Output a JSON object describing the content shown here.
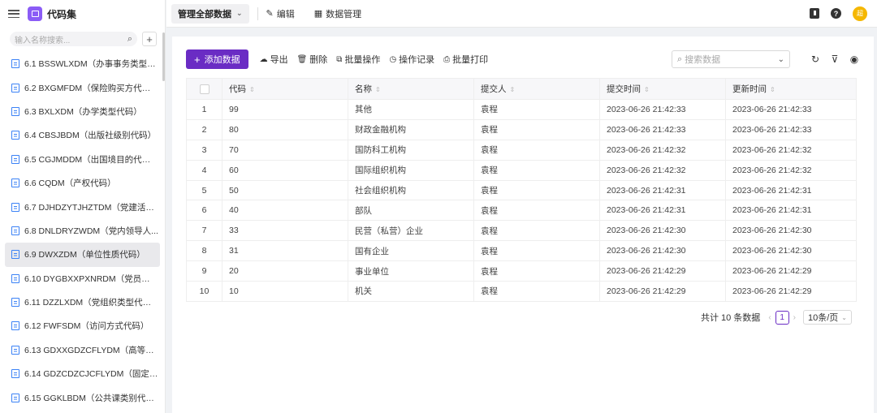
{
  "app": {
    "title": "代码集"
  },
  "sidebar": {
    "search_placeholder": "输入名称搜索...",
    "add_symbol": "+",
    "items": [
      {
        "label": "6.1 BSSWLXDM（办事事务类型代..."
      },
      {
        "label": "6.2 BXGMFDM（保险购买方代码）"
      },
      {
        "label": "6.3 BXLXDM（办学类型代码）"
      },
      {
        "label": "6.4 CBSJBDM（出版社级别代码）"
      },
      {
        "label": "6.5 CGJMDDM（出国境目的代码）"
      },
      {
        "label": "6.6 CQDM（产权代码）"
      },
      {
        "label": "6.7 DJHDZYTJHZTDM（党建活动..."
      },
      {
        "label": "6.8 DNLDRYZWDM（党内领导人..."
      },
      {
        "label": "6.9 DWXZDM（单位性质代码）"
      },
      {
        "label": "6.10 DYGBXXPXNRDM（党员干部..."
      },
      {
        "label": "6.11 DZZLXDM（党组织类型代码）"
      },
      {
        "label": "6.12 FWFSDM（访问方式代码）"
      },
      {
        "label": "6.13 GDXXGDZCFLYDM（高等学..."
      },
      {
        "label": "6.14 GDZCDZCJCFLYDM（固定资..."
      },
      {
        "label": "6.15 GGKLBDM（公共课类别代码）"
      }
    ],
    "active_index": 8
  },
  "topbar": {
    "scope_select": "管理全部数据",
    "edit_label": "编辑",
    "data_mgmt_label": "数据管理",
    "avatar_text": "超"
  },
  "toolbar": {
    "add_label": "添加数据",
    "export_label": "导出",
    "delete_label": "删除",
    "batch_label": "批量操作",
    "history_label": "操作记录",
    "print_label": "批量打印",
    "search_placeholder": "搜索数据"
  },
  "table": {
    "columns": [
      "代码",
      "名称",
      "提交人",
      "提交时间",
      "更新时间"
    ],
    "rows": [
      {
        "idx": "1",
        "code": "99",
        "name": "其他",
        "submitter": "袁程",
        "submitted": "2023-06-26 21:42:33",
        "updated": "2023-06-26 21:42:33"
      },
      {
        "idx": "2",
        "code": "80",
        "name": "财政金融机构",
        "submitter": "袁程",
        "submitted": "2023-06-26 21:42:33",
        "updated": "2023-06-26 21:42:33"
      },
      {
        "idx": "3",
        "code": "70",
        "name": "国防科工机构",
        "submitter": "袁程",
        "submitted": "2023-06-26 21:42:32",
        "updated": "2023-06-26 21:42:32"
      },
      {
        "idx": "4",
        "code": "60",
        "name": "国际组织机构",
        "submitter": "袁程",
        "submitted": "2023-06-26 21:42:32",
        "updated": "2023-06-26 21:42:32"
      },
      {
        "idx": "5",
        "code": "50",
        "name": "社会组织机构",
        "submitter": "袁程",
        "submitted": "2023-06-26 21:42:31",
        "updated": "2023-06-26 21:42:31"
      },
      {
        "idx": "6",
        "code": "40",
        "name": "部队",
        "submitter": "袁程",
        "submitted": "2023-06-26 21:42:31",
        "updated": "2023-06-26 21:42:31"
      },
      {
        "idx": "7",
        "code": "33",
        "name": "民营（私营）企业",
        "submitter": "袁程",
        "submitted": "2023-06-26 21:42:30",
        "updated": "2023-06-26 21:42:30"
      },
      {
        "idx": "8",
        "code": "31",
        "name": "国有企业",
        "submitter": "袁程",
        "submitted": "2023-06-26 21:42:30",
        "updated": "2023-06-26 21:42:30"
      },
      {
        "idx": "9",
        "code": "20",
        "name": "事业单位",
        "submitter": "袁程",
        "submitted": "2023-06-26 21:42:29",
        "updated": "2023-06-26 21:42:29"
      },
      {
        "idx": "10",
        "code": "10",
        "name": "机关",
        "submitter": "袁程",
        "submitted": "2023-06-26 21:42:29",
        "updated": "2023-06-26 21:42:29"
      }
    ]
  },
  "pagination": {
    "total_text": "共计 10 条数据",
    "current_page": "1",
    "page_size": "10条/页"
  },
  "colors": {
    "accent": "#6a2cc4",
    "logo": "#8b5cf6",
    "avatar": "#f5b700",
    "doc_icon": "#3b82f6"
  },
  "icons": [
    "menu-icon",
    "app-logo-icon",
    "search-icon",
    "plus-icon",
    "document-icon",
    "chevron-down-icon",
    "pencil-icon",
    "table-icon",
    "book-icon",
    "help-icon",
    "cloud-upload-icon",
    "trash-icon",
    "copy-icon",
    "clock-icon",
    "printer-icon",
    "refresh-icon",
    "filter-icon",
    "eye-icon",
    "chevron-left-icon",
    "chevron-right-icon"
  ]
}
